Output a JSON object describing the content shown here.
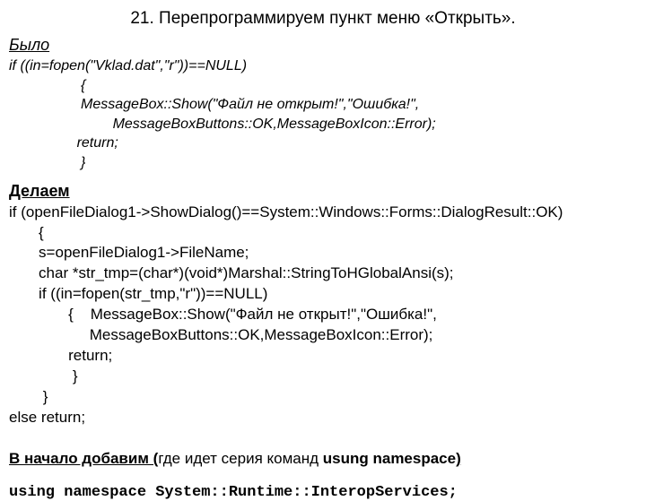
{
  "title": "21. Перепрограммируем пункт меню «Открыть».",
  "was": {
    "heading": "Было",
    "code": "if ((in=fopen(\"Vklad.dat\",\"r\"))==NULL)\n                  {\n                  MessageBox::Show(\"Файл не открыт!\",\"Ошибка!\",\n                          MessageBoxButtons::OK,MessageBoxIcon::Error);\n                 return;\n                  }"
  },
  "do": {
    "heading": "Делаем",
    "code": "if (openFileDialog1->ShowDialog()==System::Windows::Forms::DialogResult::OK)\n       {\n       s=openFileDialog1->FileName;\n       char *str_tmp=(char*)(void*)Marshal::StringToHGlobalAnsi(s);\n       if ((in=fopen(str_tmp,\"r\"))==NULL)\n              {    MessageBox::Show(\"Файл не открыт!\",\"Ошибка!\",\n                   MessageBoxButtons::OK,MessageBoxIcon::Error);\n              return;\n               }\n        }\nelse return;"
  },
  "addNote": {
    "prefix": "В начало добавим (",
    "middle": "где идет серия команд   ",
    "bold": "usung namespace",
    "suffix": ")"
  },
  "usingLine": "using namespace System::Runtime::InteropServices;"
}
